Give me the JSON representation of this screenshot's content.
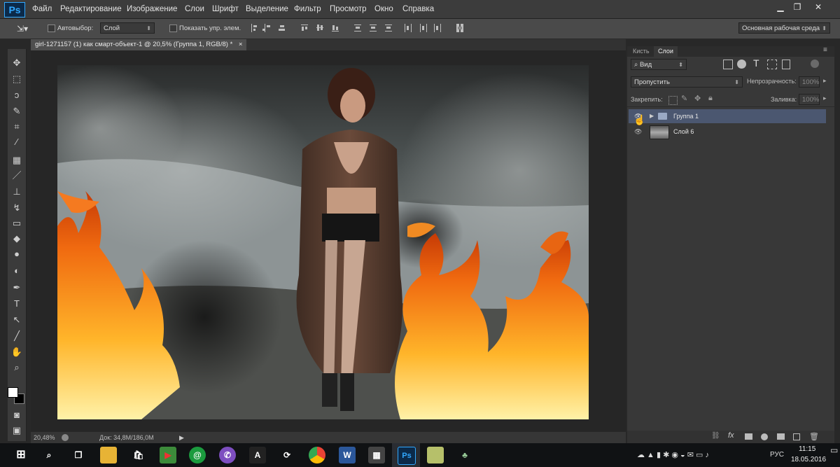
{
  "app": {
    "logo": "Ps"
  },
  "menu": [
    "Файл",
    "Редактирование",
    "Изображение",
    "Слои",
    "Шрифт",
    "Выделение",
    "Фильтр",
    "Просмотр",
    "Окно",
    "Справка"
  ],
  "window_controls": {
    "minimize": "▁",
    "restore": "❐",
    "close": "✕"
  },
  "options": {
    "autoselect_label": "Автовыбор:",
    "autoselect_target": "Слой",
    "show_controls_label": "Показать упр. элем.",
    "workspace": "Основная рабочая среда"
  },
  "document": {
    "tab_title": "girl-1271157 (1) как смарт-объект-1 @ 20,5% (Группа 1, RGB/8) *",
    "close": "×"
  },
  "status": {
    "zoom": "20,48%",
    "doc": "Док: 34,8M/186,0M"
  },
  "panel": {
    "tabs": [
      "Кисть",
      "Слои"
    ],
    "active_tab": "Слои",
    "filter_kind": "Вид",
    "blend_mode": "Пропустить",
    "opacity_label": "Непрозрачность:",
    "opacity_value": "100%",
    "lock_label": "Закрепить:",
    "fill_label": "Заливка:",
    "fill_value": "100%",
    "layers": [
      {
        "name": "Группа 1",
        "type": "group",
        "selected": true
      },
      {
        "name": "Слой 6",
        "type": "layer",
        "selected": false
      }
    ]
  },
  "taskbar": {
    "language": "РУС",
    "time": "11:15",
    "date": "18.05.2016"
  },
  "colors": {
    "accent": "#31a8ff",
    "selected_layer": "#4b5770"
  }
}
